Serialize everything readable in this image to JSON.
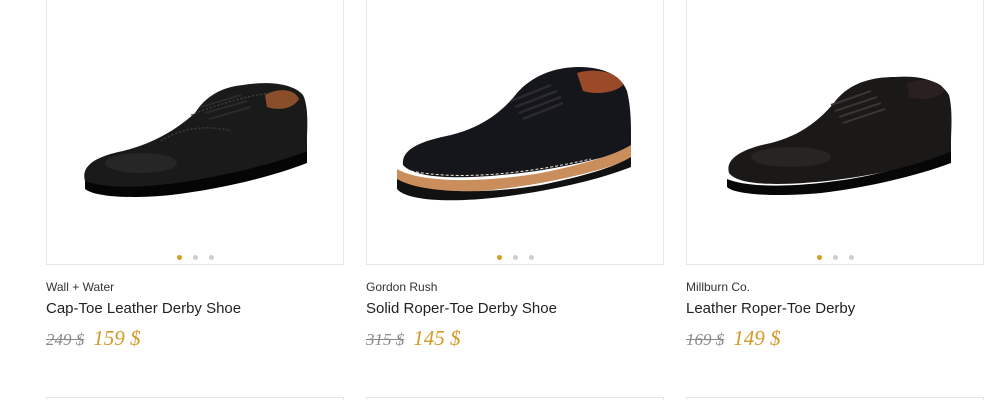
{
  "products": [
    {
      "brand": "Wall + Water",
      "name": "Cap-Toe Leather Derby Shoe",
      "old_price": "249 $",
      "new_price": "159 $",
      "image_icon": "captoe-derby-shoe-image",
      "active_dot": 1
    },
    {
      "brand": "Gordon Rush",
      "name": "Solid Roper-Toe Derby Shoe",
      "old_price": "315 $",
      "new_price": "145 $",
      "image_icon": "suede-derby-shoe-image",
      "active_dot": 1
    },
    {
      "brand": "Millburn Co.",
      "name": "Leather Roper-Toe Derby",
      "old_price": "169 $",
      "new_price": "149 $",
      "image_icon": "leather-derby-shoe-image",
      "active_dot": 1
    }
  ],
  "colors": {
    "accent": "#d4a020",
    "price": "#d49a26",
    "old_price": "#8a8a8a"
  }
}
